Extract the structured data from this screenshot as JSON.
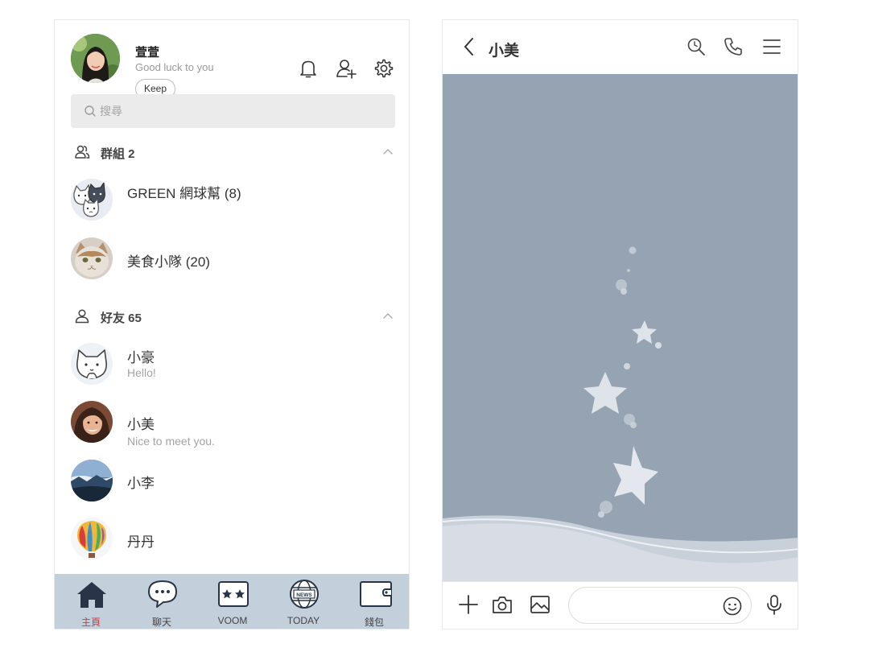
{
  "profile": {
    "name": "萱萱",
    "status": "Good luck to you",
    "keep_label": "Keep"
  },
  "search": {
    "placeholder": "搜尋"
  },
  "groups": {
    "label": "群組 2",
    "items": [
      {
        "name": "GREEN 網球幫 (8)"
      },
      {
        "name": "美食小隊 (20)"
      }
    ]
  },
  "friends": {
    "label": "好友 65",
    "items": [
      {
        "name": "小豪",
        "status": "Hello!"
      },
      {
        "name": "小美",
        "status": "Nice to meet you."
      },
      {
        "name": "小李",
        "status": ""
      },
      {
        "name": "丹丹",
        "status": ""
      }
    ]
  },
  "tabs": [
    {
      "label": "主頁",
      "icon": "home-icon",
      "active": true
    },
    {
      "label": "聊天",
      "icon": "chat-bubble-icon",
      "active": false
    },
    {
      "label": "VOOM",
      "icon": "voom-icon",
      "active": false
    },
    {
      "label": "TODAY",
      "icon": "news-globe-icon",
      "active": false
    },
    {
      "label": "錢包",
      "icon": "wallet-icon",
      "active": false
    }
  ],
  "chat": {
    "title": "小美",
    "message_placeholder": ""
  },
  "colors": {
    "tabbar_bg": "#c4cfdc",
    "chat_bg": "#96a3b2",
    "active_tab": "#e3342f"
  }
}
